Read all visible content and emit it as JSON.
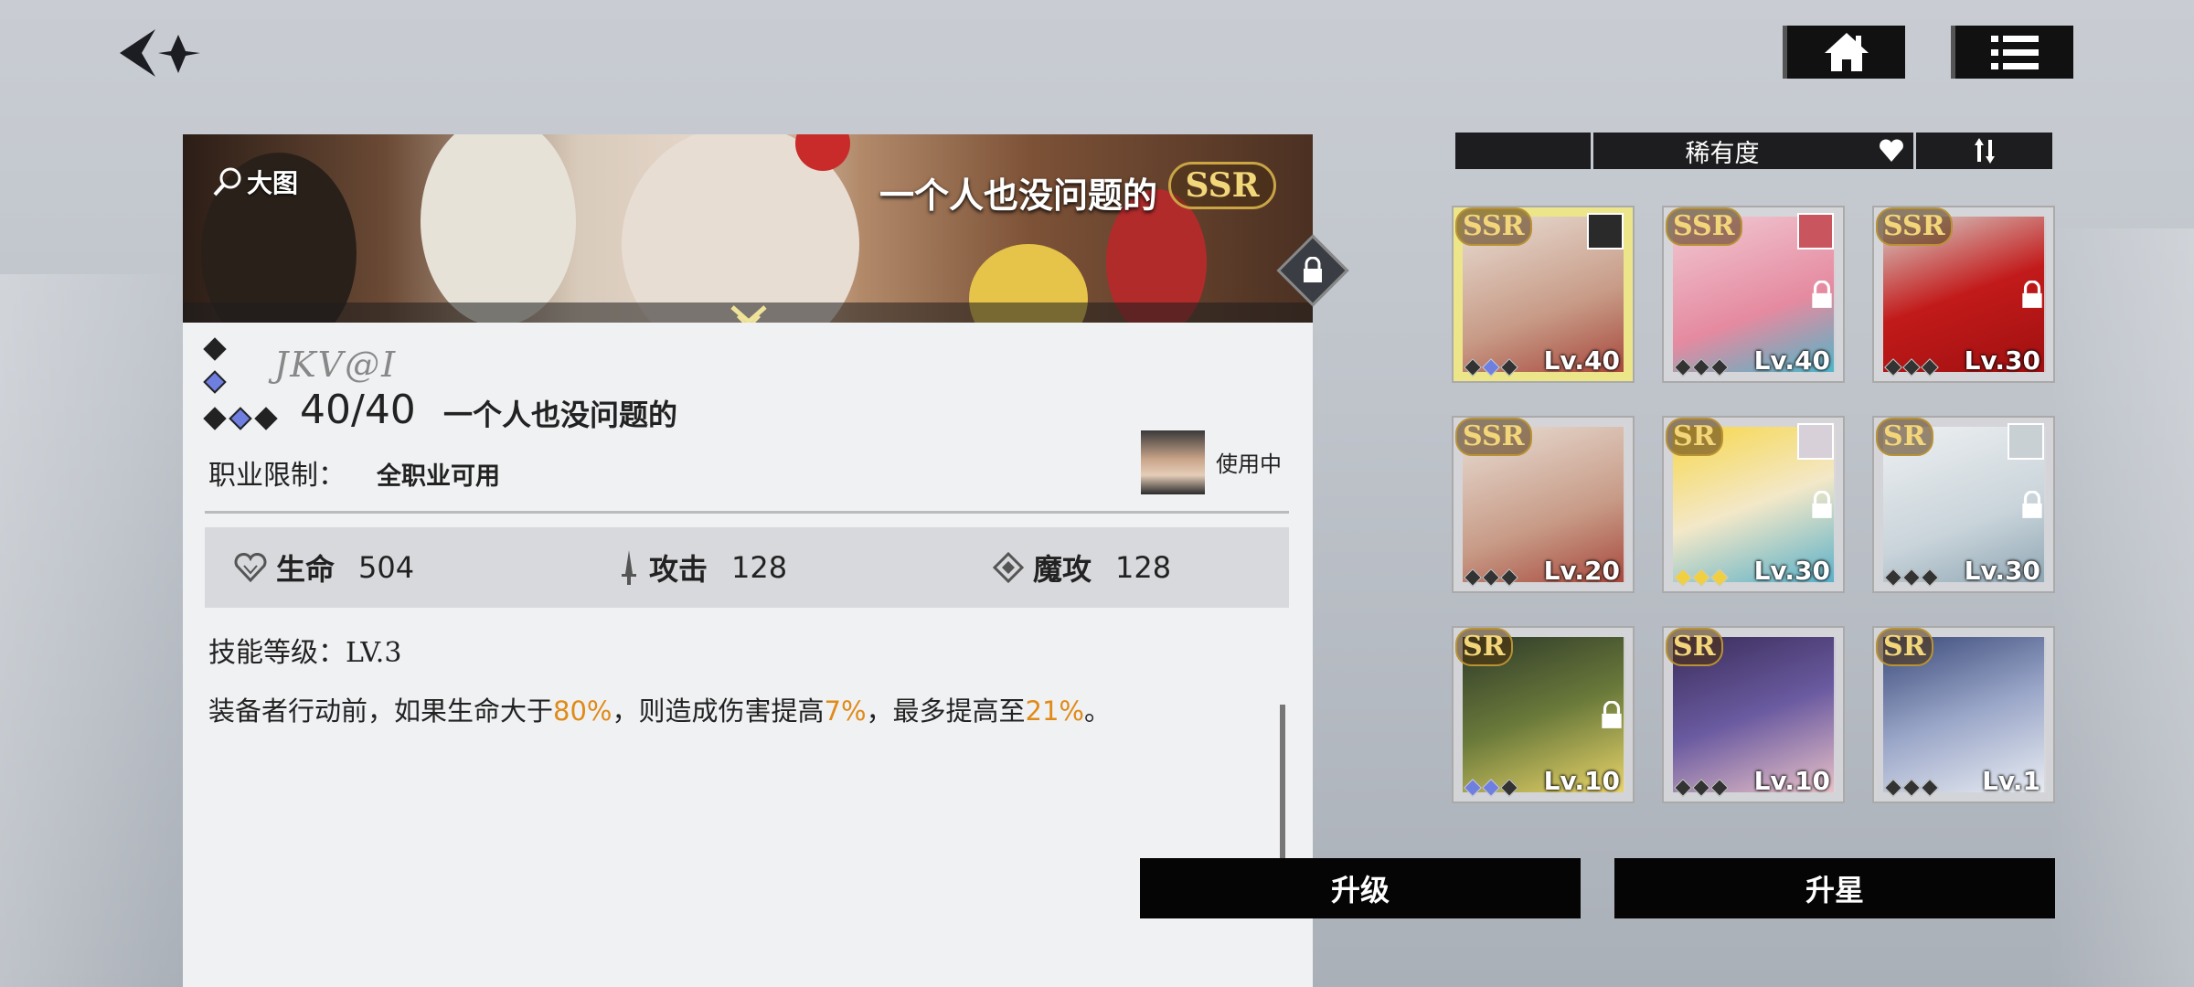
{
  "topbar": {
    "back_icon": "back-arrow-icon",
    "home_icon": "home-icon",
    "menu_icon": "list-menu-icon"
  },
  "banner": {
    "big_image_label": "大图",
    "title": "一个人也没问题的",
    "rarity": "SSR"
  },
  "equipment": {
    "signature_text": "JKV@I",
    "level": "40/40",
    "name": "一个人也没问题的",
    "job_label": "职业限制：",
    "job_value": "全职业可用",
    "in_use": "使用中",
    "stats": [
      {
        "label": "生命",
        "value": "504",
        "icon": "heart-icon"
      },
      {
        "label": "攻击",
        "value": "128",
        "icon": "sword-icon"
      },
      {
        "label": "魔攻",
        "value": "128",
        "icon": "magic-icon"
      }
    ],
    "skill_level": "技能等级：LV.3",
    "desc_parts": {
      "p1": "装备者行动前，如果生命大于",
      "v1": "80%",
      "p2": "，则造成伤害提高",
      "v2": "7%",
      "p3": "，最多提高至",
      "v3": "21%",
      "p4": "。"
    }
  },
  "sort": {
    "label": "稀有度"
  },
  "cards": [
    {
      "rarity": "SSR",
      "level": "Lv.40",
      "locked": false,
      "selected": true
    },
    {
      "rarity": "SSR",
      "level": "Lv.40",
      "locked": true,
      "selected": false
    },
    {
      "rarity": "SSR",
      "level": "Lv.30",
      "locked": true,
      "selected": false
    },
    {
      "rarity": "SSR",
      "level": "Lv.20",
      "locked": false,
      "selected": false
    },
    {
      "rarity": "SR",
      "level": "Lv.30",
      "locked": true,
      "selected": false
    },
    {
      "rarity": "SR",
      "level": "Lv.30",
      "locked": true,
      "selected": false
    },
    {
      "rarity": "SR",
      "level": "Lv.10",
      "locked": true,
      "selected": false
    },
    {
      "rarity": "SR",
      "level": "Lv.10",
      "locked": false,
      "selected": false
    },
    {
      "rarity": "SR",
      "level": "Lv.1",
      "locked": false,
      "selected": false
    }
  ],
  "actions": {
    "upgrade": "升级",
    "star_up": "升星"
  },
  "colors": {
    "highlight": "#e08a18",
    "button_bg": "#050505",
    "rarity_gold": "#f3d67a"
  }
}
